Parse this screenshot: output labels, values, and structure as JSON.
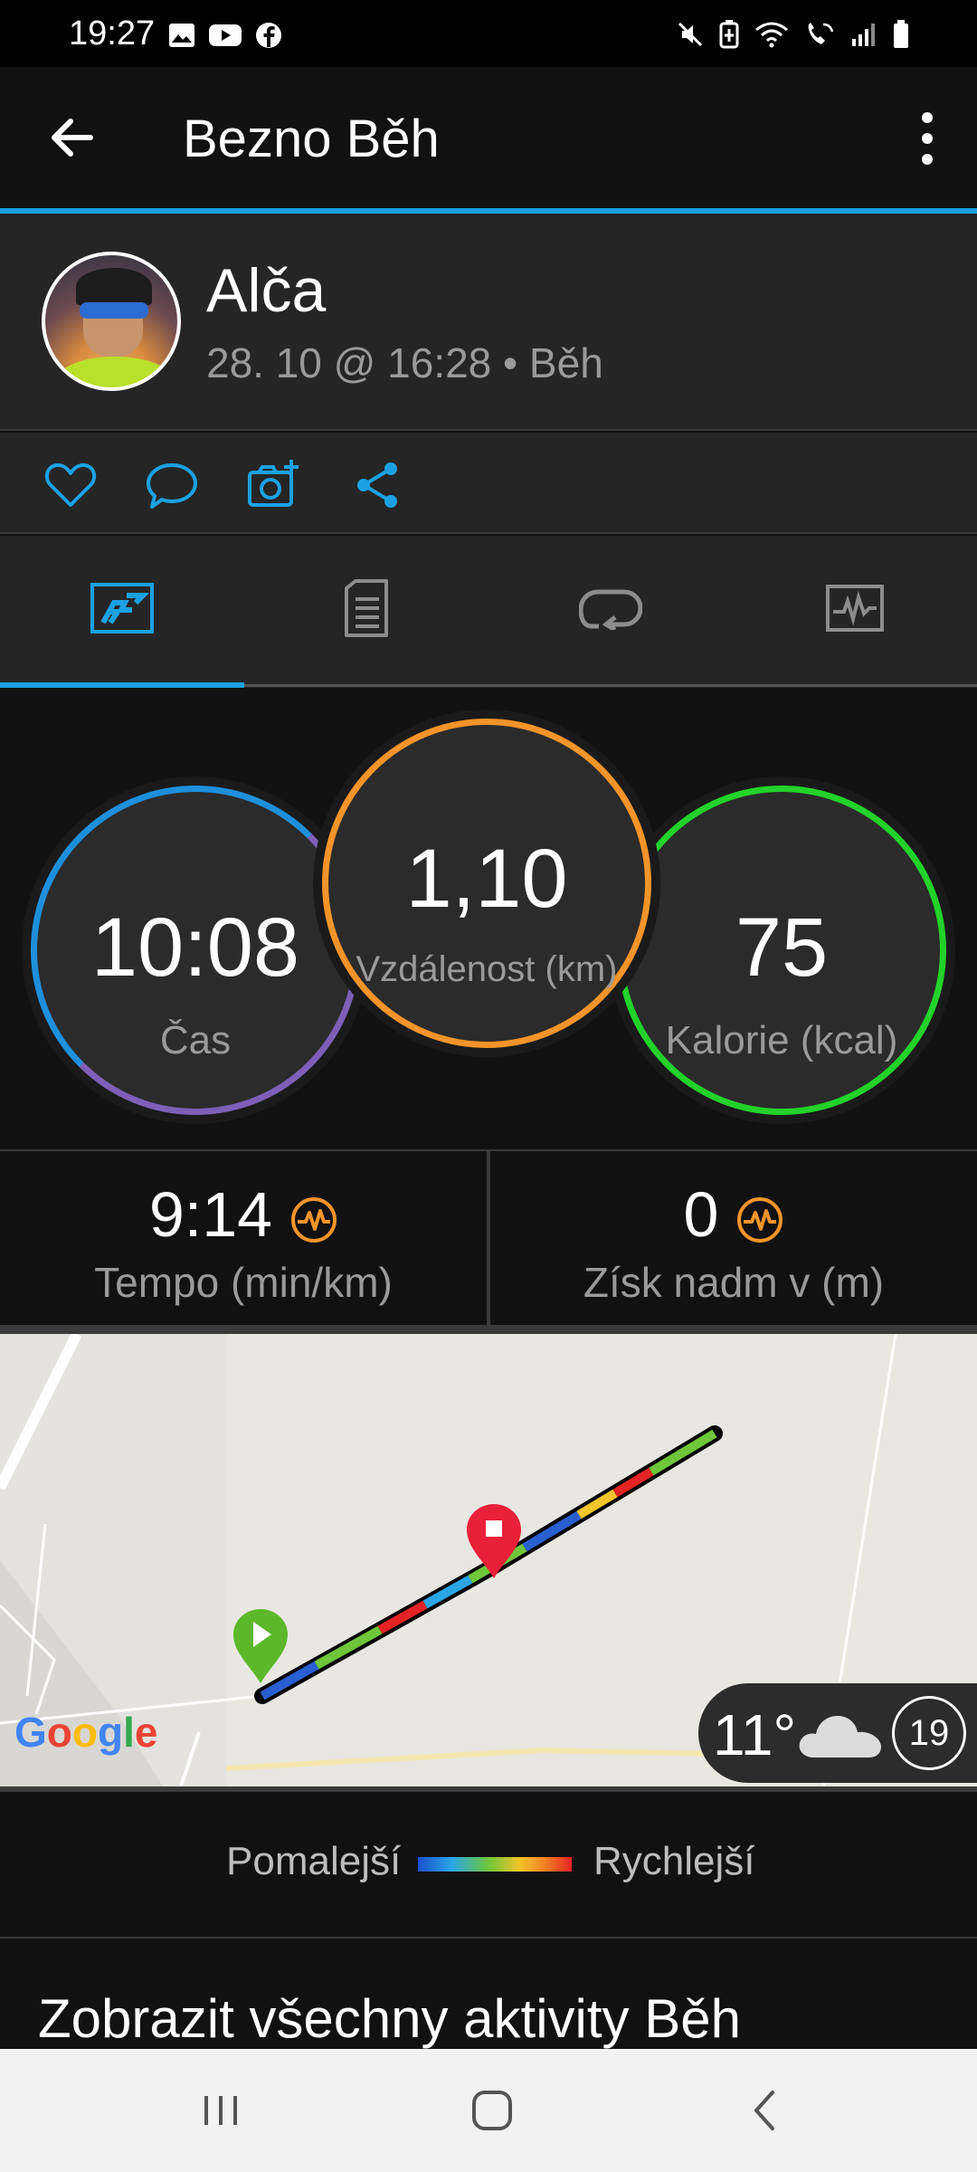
{
  "status_bar": {
    "time": "19:27"
  },
  "app_bar": {
    "title": "Bezno Běh"
  },
  "profile": {
    "name": "Alča",
    "meta": "28. 10 @ 16:28 • Běh"
  },
  "actions": [
    {
      "icon": "heart-icon"
    },
    {
      "icon": "comment-icon"
    },
    {
      "icon": "camera-add-icon"
    },
    {
      "icon": "share-icon"
    }
  ],
  "tabs": [
    {
      "icon": "overview-icon",
      "active": true
    },
    {
      "icon": "details-icon",
      "active": false
    },
    {
      "icon": "laps-icon",
      "active": false
    },
    {
      "icon": "charts-icon",
      "active": false
    }
  ],
  "stats": {
    "time": {
      "value": "10:08",
      "label": "Čas"
    },
    "distance": {
      "value": "1,10",
      "label": "Vzdálenost (km)"
    },
    "calories": {
      "value": "75",
      "label": "Kalorie (kcal)"
    }
  },
  "metrics": {
    "pace": {
      "value": "9:14",
      "label": "Tempo (min/km)"
    },
    "elevation": {
      "value": "0",
      "label": "Získ nadm v (m)"
    }
  },
  "map": {
    "provider": "Google",
    "weather_temp": "11°",
    "moon_day": "19"
  },
  "legend": {
    "slow": "Pomalejší",
    "fast": "Rychlejší"
  },
  "link": {
    "label": "Zobrazit všechny aktivity Běh"
  },
  "colors": {
    "accent": "#1ba1e2",
    "orange": "#f3942a",
    "green": "#22d22a",
    "purple": "#7d5fb8"
  }
}
